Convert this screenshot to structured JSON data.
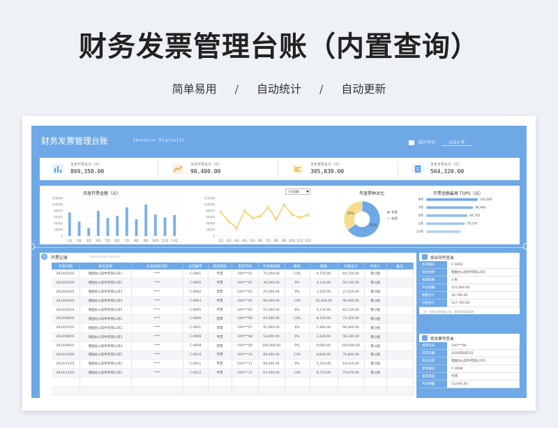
{
  "hero": {
    "title": "财务发票管理台账（内置查询）",
    "tags": [
      "简单易用",
      "自动统计",
      "自动更新"
    ],
    "separator": "/"
  },
  "banner": {
    "title": "财务发票管理台账",
    "subtitle": "Invoice Statistic",
    "year_label": "统计年份：",
    "year_value": "2024 年"
  },
  "kpis": [
    {
      "label": "全年开票合计（元）",
      "value": "869,350.00",
      "icon": "bar-chart-icon",
      "color": "#5b9be0"
    },
    {
      "label": "本月开票合计（元）",
      "value": "90,400.00",
      "icon": "trend-line-icon",
      "color": "#f0a04a"
    },
    {
      "label": "全年普票合计（元）",
      "value": "305,030.00",
      "icon": "wallet-icon",
      "color": "#f2c46b"
    },
    {
      "label": "全年专票合计（元）",
      "value": "564,320.00",
      "icon": "document-icon",
      "color": "#5b9be0"
    }
  ],
  "charts": {
    "monthly_title": "月度开票金额（元）",
    "dropdown_value": "不含税额",
    "pie_title": "年度票种对比",
    "top5_title": "开票金额最高 TOP5（元）"
  },
  "chart_data": [
    {
      "type": "bar",
      "title": "月度开票金额（元）",
      "categories": [
        "1月",
        "2月",
        "3月",
        "4月",
        "5月",
        "6月",
        "7月",
        "8月",
        "9月",
        "10月",
        "11月",
        "12月"
      ],
      "values": [
        75000,
        46000,
        25000,
        80000,
        57000,
        64000,
        91000,
        53000,
        100000,
        68000,
        59000,
        67000
      ],
      "ylim": [
        0,
        120000
      ],
      "yticks": [
        "0",
        "20000",
        "40000",
        "60000",
        "80000",
        "100000",
        "120000"
      ],
      "color": "#7ab0e8"
    },
    {
      "type": "line",
      "categories": [
        "1月",
        "2月",
        "3月",
        "4月",
        "5月",
        "6月",
        "7月",
        "8月",
        "9月",
        "10月",
        "11月",
        "12月"
      ],
      "values": [
        75000,
        46000,
        25000,
        80000,
        57000,
        64000,
        91000,
        53000,
        100000,
        68000,
        59000,
        67000
      ],
      "ylim": [
        0,
        120000
      ],
      "yticks": [
        "0",
        "20000",
        "40000",
        "60000",
        "80000",
        "100000",
        "120000"
      ],
      "color": "#f2c23c"
    },
    {
      "type": "pie",
      "title": "年度票种对比",
      "labels": [
        "专票",
        "普票"
      ],
      "values": [
        65,
        35
      ],
      "data_labels": [
        "65%",
        "35%"
      ],
      "colors": [
        "#6ea8e6",
        "#f7dc8c"
      ]
    },
    {
      "type": "bar",
      "orientation": "horizontal",
      "title": "开票金额最高 TOP5（元）",
      "categories": [
        "9月",
        "7月",
        "4月",
        "1月",
        "12月"
      ],
      "values": [
        100000,
        91000,
        80000,
        75000,
        67000
      ],
      "data_labels": [
        "100,000",
        "96,460",
        "84,750",
        "79,570"
      ],
      "color": "#6ea8e6"
    }
  ],
  "records": {
    "badge": "30",
    "title": "开票记录",
    "subtitle": "Invoicing record",
    "columns": [
      "开票日期",
      "单位名称",
      "社会信用代码",
      "合同编号",
      "发票类别",
      "发票号码",
      "不含税金额",
      "税率",
      "税额",
      "价税合计",
      "开票人",
      "备注"
    ],
    "rows": [
      [
        "2024/01/01",
        "我图办公软件有限公司1",
        "****",
        "C-0001",
        "专票",
        "100***01",
        "75,000.00",
        "13%",
        "9,750.00",
        "84,750.00",
        "我小图",
        ""
      ],
      [
        "2024/02/01",
        "我图办公软件有限公司2",
        "****",
        "C-0002",
        "专票",
        "100***02",
        "46,000.00",
        "9%",
        "4,140.00",
        "50,140.00",
        "我小图",
        ""
      ],
      [
        "2024/03/01",
        "我图办公软件有限公司3",
        "****",
        "C-0002",
        "普票",
        "100***03",
        "25,000.00",
        "9%",
        "2,250.00",
        "27,250.00",
        "我小图",
        ""
      ],
      [
        "2024/04/01",
        "我图办公软件有限公司4",
        "****",
        "C-0003",
        "专票",
        "100***04",
        "80,000.00",
        "13%",
        "10,400.00",
        "90,400.00",
        "我小图",
        ""
      ],
      [
        "2024/05/01",
        "我图办公软件有限公司5",
        "****",
        "C-0005",
        "专票",
        "100***05",
        "57,000.00",
        "9%",
        "5,130.00",
        "62,130.00",
        "我小图",
        ""
      ],
      [
        "2024/06/01",
        "我图办公软件有限公司1",
        "****",
        "C-0006",
        "普票",
        "100***06",
        "64,000.00",
        "13%",
        "8,320.00",
        "72,320.00",
        "我小图",
        ""
      ],
      [
        "2024/07/01",
        "我图办公软件有限公司2",
        "****",
        "C-0001",
        "普票",
        "100***07",
        "91,000.00",
        "6%",
        "5,460.00",
        "96,460.00",
        "我小图",
        ""
      ],
      [
        "2024/08/01",
        "我图办公软件有限公司3",
        "****",
        "C-0008",
        "专票",
        "100***08",
        "53,000.00",
        "6%",
        "3,180.00",
        "56,180.00",
        "我小图",
        ""
      ],
      [
        "2024/09/01",
        "我图办公软件有限公司4",
        "****",
        "C-0009",
        "普票",
        "100***09",
        "100,000.00",
        "9%",
        "9,000.00",
        "109,000.00",
        "我小图",
        ""
      ],
      [
        "2024/10/01",
        "我图办公软件有限公司5",
        "****",
        "C-0010",
        "专票",
        "100***10",
        "68,000.00",
        "13%",
        "8,840.00",
        "76,840.00",
        "我小图",
        ""
      ],
      [
        "2024/11/01",
        "我图办公软件有限公司1",
        "****",
        "C-0011",
        "专票",
        "100***11",
        "59,000.00",
        "9%",
        "5,310.00",
        "64,310.00",
        "我小图",
        ""
      ],
      [
        "2024/12/01",
        "我图办公软件有限公司2",
        "****",
        "C-0012",
        "专票",
        "100***12",
        "67,000.00",
        "13%",
        "8,710.00",
        "79,570.00",
        "我小图",
        ""
      ],
      [
        "",
        "",
        "",
        "",
        "",
        "",
        "",
        "",
        "-",
        "-",
        "",
        ""
      ],
      [
        "",
        "",
        "",
        "",
        "",
        "",
        "",
        "",
        "",
        "",
        "",
        ""
      ]
    ]
  },
  "contract_lookup": {
    "title": "按合同号查询",
    "rows": [
      {
        "k": "合同编号",
        "v": "C-0002"
      },
      {
        "k": "单位名称",
        "v": "我图办公软件有限公司2"
      },
      {
        "k": "发票张数",
        "v": "3 张"
      },
      {
        "k": "不含税额",
        "v": "151,000.00"
      },
      {
        "k": "税额合计",
        "v": "16,790.00"
      },
      {
        "k": "价税合计",
        "v": "167,790.00"
      }
    ],
    "note": "注：灰色区域内嵌公式，请勿填写或清除"
  },
  "invoice_lookup": {
    "title": "按发票号查询",
    "rows": [
      {
        "k": "发票号码",
        "v": "100***08"
      },
      {
        "k": "开票日期",
        "v": "2024年8月1日"
      },
      {
        "k": "单位名称",
        "v": "我图办公软件有限公司3"
      },
      {
        "k": "合同编号",
        "v": "C-0008"
      },
      {
        "k": "发票类型",
        "v": "专票"
      },
      {
        "k": "不含税额",
        "v": "53,000.00"
      }
    ]
  }
}
